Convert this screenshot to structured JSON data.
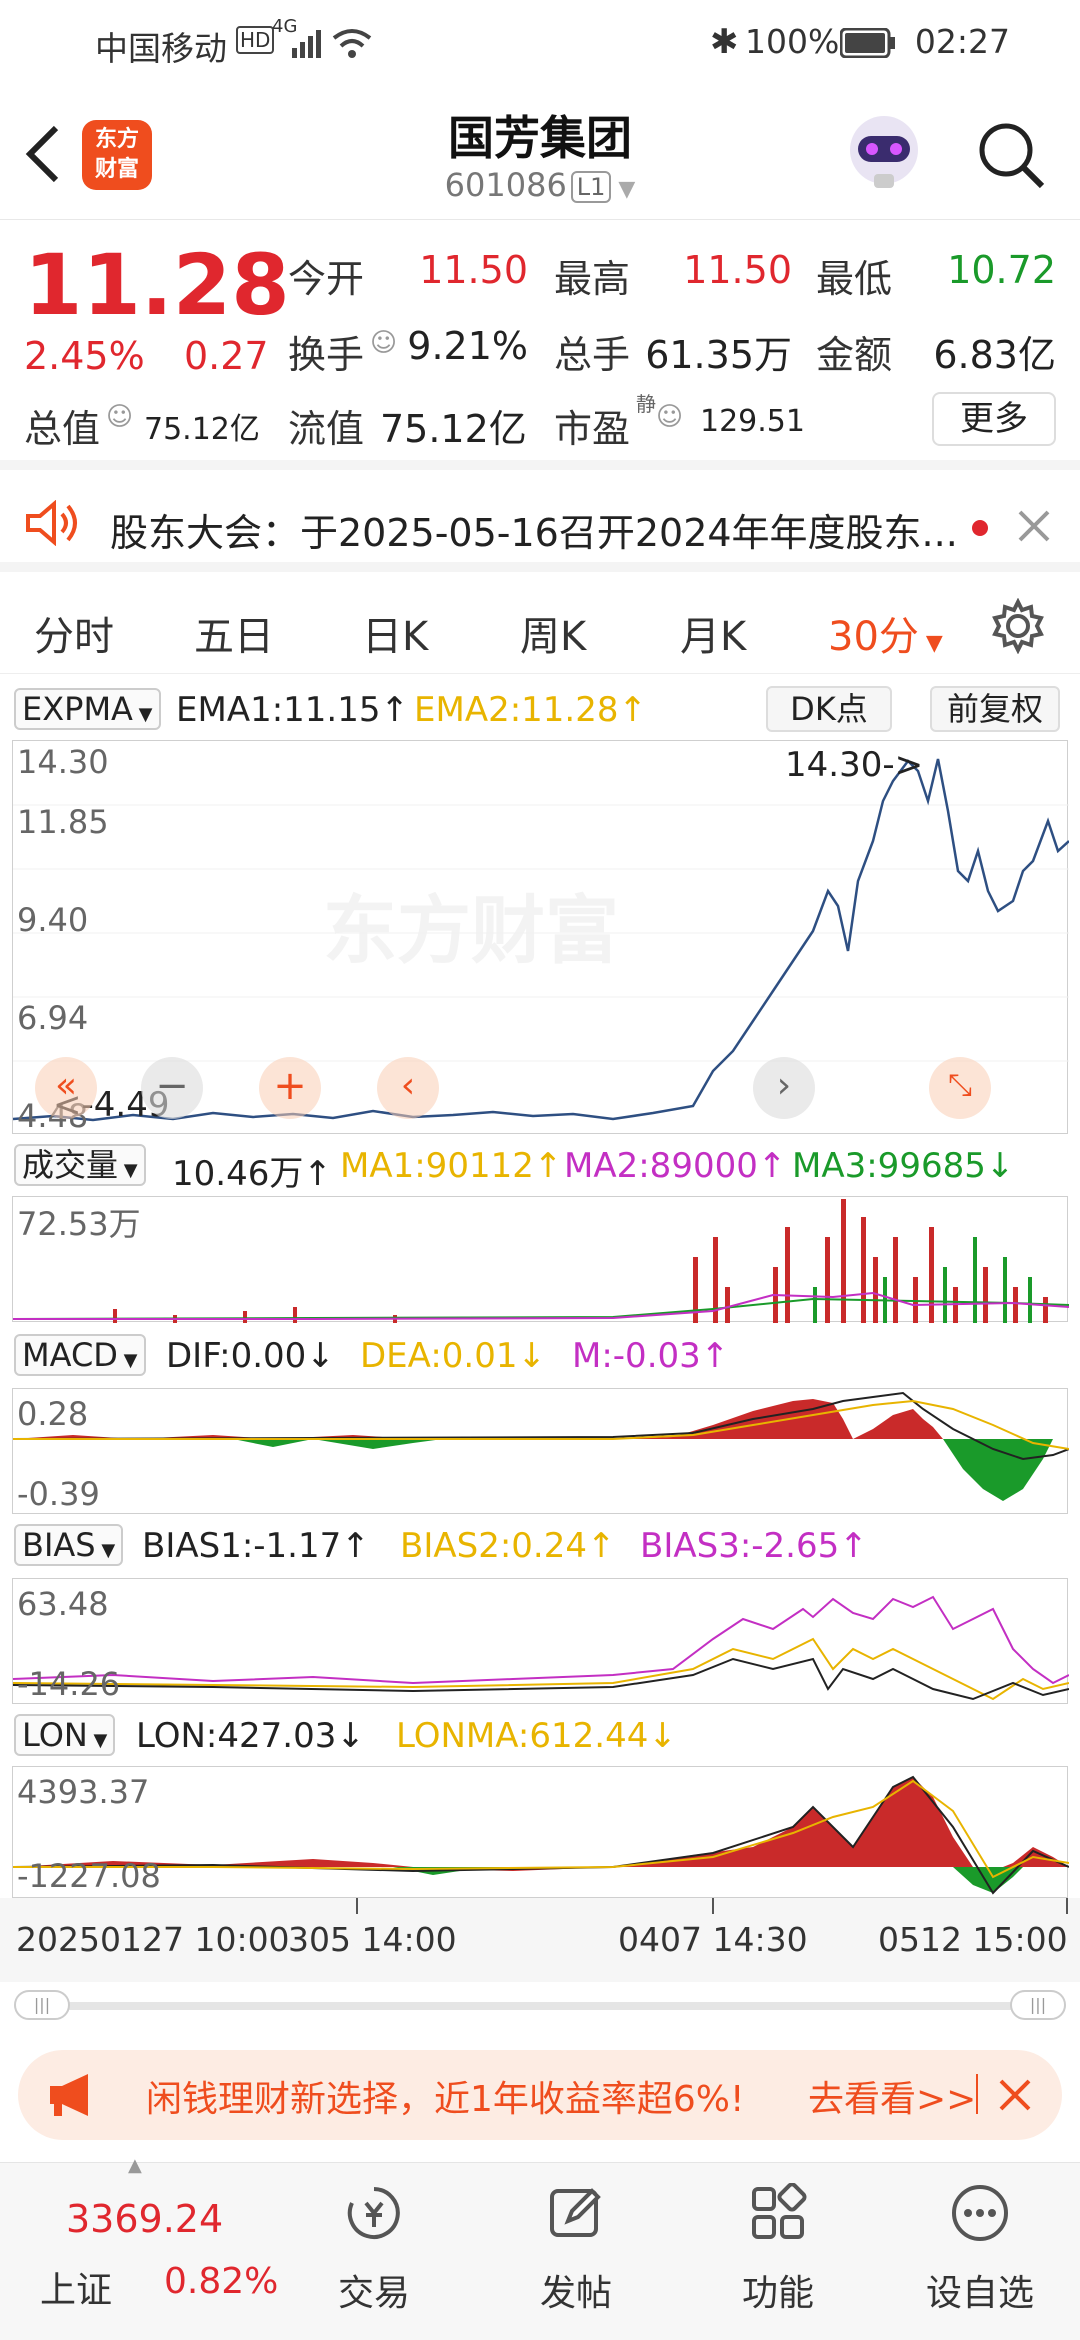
{
  "status_bar": {
    "carrier": "中国移动",
    "network": "4G",
    "battery": "100%",
    "time": "02:27"
  },
  "header": {
    "stock_name": "国芳集团",
    "stock_code": "601086",
    "level": "L1",
    "logo_line1": "东方",
    "logo_line2": "财富"
  },
  "quote": {
    "price": "11.28",
    "change_pct": "2.45%",
    "change": "0.27",
    "open_label": "今开",
    "open": "11.50",
    "high_label": "最高",
    "high": "11.50",
    "low_label": "最低",
    "low": "10.72",
    "turnover_label": "换手",
    "turnover": "9.21%",
    "volume_label": "总手",
    "volume": "61.35万",
    "amount_label": "金额",
    "amount": "6.83亿",
    "mcap_label": "总值",
    "mcap": "75.12亿",
    "float_label": "流值",
    "float_cap": "75.12亿",
    "pe_label": "市盈",
    "pe_sup": "静",
    "pe": "129.51",
    "more_label": "更多"
  },
  "notice": {
    "text": "股东大会：于2025-05-16召开2024年年度股东..."
  },
  "tabs": [
    "分时",
    "五日",
    "日K",
    "周K",
    "月K",
    "30分"
  ],
  "main_chart": {
    "indicator": "EXPMA",
    "ema1": "EMA1:11.15↑",
    "ema2": "EMA2:11.28↑",
    "dk_button": "DK点",
    "adjust_button": "前复权",
    "y_labels": [
      "14.30",
      "11.85",
      "9.40",
      "6.94",
      "4.48"
    ],
    "max_marker": "14.30->",
    "min_marker": "<-4.49",
    "watermark": "东方财富"
  },
  "volume_panel": {
    "indicator": "成交量",
    "value": "10.46万↑",
    "ma1": "MA1:90112↑",
    "ma2": "MA2:89000↑",
    "ma3": "MA3:99685↓",
    "y_max": "72.53万"
  },
  "macd_panel": {
    "indicator": "MACD",
    "dif": "DIF:0.00↓",
    "dea": "DEA:0.01↓",
    "m": "M:-0.03↑",
    "y_max": "0.28",
    "y_min": "-0.39"
  },
  "bias_panel": {
    "indicator": "BIAS",
    "bias1": "BIAS1:-1.17↑",
    "bias2": "BIAS2:0.24↑",
    "bias3": "BIAS3:-2.65↑",
    "y_max": "63.48",
    "y_min": "-14.26"
  },
  "lon_panel": {
    "indicator": "LON",
    "lon": "LON:427.03↓",
    "lonma": "LONMA:612.44↓",
    "y_max": "4393.37",
    "y_min": "-1227.08"
  },
  "x_axis": {
    "left": "20250127 10:00",
    "mid1": "305 14:00",
    "mid2": "0407 14:30",
    "right": "0512 15:00"
  },
  "promo": {
    "text": "闲钱理财新选择，近1年收益率超6%!",
    "link": "去看看>>"
  },
  "bottom_nav": {
    "index_value": "3369.24",
    "index_name": "上证",
    "index_change": "0.82%",
    "trade": "交易",
    "post": "发帖",
    "functions": "功能",
    "watchlist": "设自选"
  },
  "colors": {
    "up": "#e0272e",
    "down": "#1a9a2a",
    "accent": "#ef4d1e",
    "ema2": "#e8b400",
    "magenta": "#c32fc3"
  }
}
